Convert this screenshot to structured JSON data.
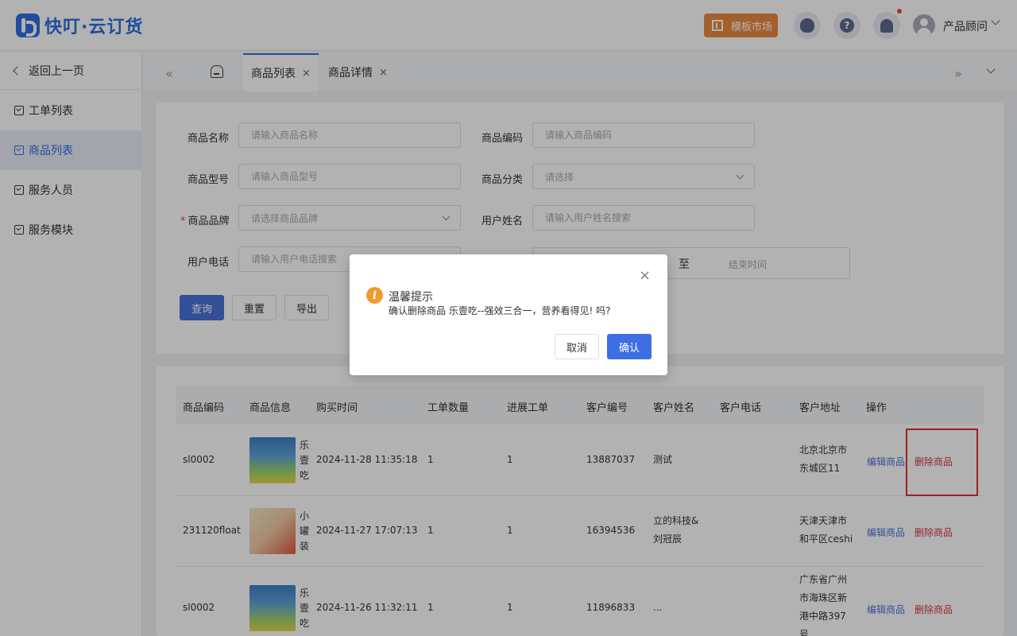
{
  "header": {
    "logo_text": "快叮·云订货",
    "template_market": "模板市场",
    "support_icon": "headset-icon",
    "help_icon": "question-icon",
    "help_glyph": "?",
    "bell_icon": "bell-icon",
    "user_name": "产品顾问"
  },
  "sidebar": {
    "back": "返回上一页",
    "items": [
      {
        "label": "工单列表"
      },
      {
        "label": "商品列表"
      },
      {
        "label": "服务人员"
      },
      {
        "label": "服务模块"
      }
    ]
  },
  "tabs": {
    "prev_glyph": "«",
    "next_glyph": "»",
    "items": [
      {
        "label": "商品列表",
        "close": "×"
      },
      {
        "label": "商品详情",
        "close": "×"
      }
    ]
  },
  "filters": {
    "product_name": {
      "label": "商品名称",
      "placeholder": "请输入商品名称"
    },
    "product_code": {
      "label": "商品编码",
      "placeholder": "请输入商品编码"
    },
    "product_model": {
      "label": "商品型号",
      "placeholder": "请输入商品型号"
    },
    "product_category": {
      "label": "商品分类",
      "placeholder": "请选择"
    },
    "product_brand": {
      "label": "商品品牌",
      "required_mark": "*",
      "placeholder": "请选择商品品牌"
    },
    "user_name": {
      "label": "用户姓名",
      "placeholder": "请输入用户姓名搜索"
    },
    "user_phone": {
      "label": "用户电话",
      "placeholder": "请输入用户电话搜索"
    },
    "date_separator": "至",
    "date_end_placeholder": "结束时间",
    "buttons": {
      "query": "查询",
      "reset": "重置",
      "export": "导出"
    }
  },
  "table": {
    "columns": [
      "商品编码",
      "商品信息",
      "购买时间",
      "工单数量",
      "进展工单",
      "客户编号",
      "客户姓名",
      "客户电话",
      "客户地址",
      "操作"
    ],
    "rows": [
      {
        "code": "sl0002",
        "name_lines": [
          "乐",
          "壹",
          "吃"
        ],
        "buy_time": "2024-11-28 11:35:18",
        "orders": "1",
        "progress": "1",
        "customer_no": "13887037",
        "customer_name_lines": [
          "测试"
        ],
        "phone": "",
        "address_lines": [
          "北京北京市",
          "东城区11"
        ],
        "edit": "编辑商品",
        "delete": "删除商品"
      },
      {
        "code": "231120float",
        "name_lines": [
          "小",
          "罐",
          "装"
        ],
        "buy_time": "2024-11-27 17:07:13",
        "orders": "1",
        "progress": "1",
        "customer_no": "16394536",
        "customer_name_lines": [
          "立的科技&",
          "刘冠辰"
        ],
        "phone": "",
        "address_lines": [
          "天津天津市",
          "和平区ceshi"
        ],
        "edit": "编辑商品",
        "delete": "删除商品"
      },
      {
        "code": "sl0002",
        "name_lines": [
          "乐",
          "壹",
          "吃"
        ],
        "buy_time": "2024-11-26 11:32:11",
        "orders": "1",
        "progress": "1",
        "customer_no": "11896833",
        "customer_name_lines": [
          "..."
        ],
        "phone": "",
        "address_lines": [
          "广东省广州",
          "市海珠区新",
          "港中路397",
          "号"
        ],
        "edit": "编辑商品",
        "delete": "删除商品"
      }
    ]
  },
  "dialog": {
    "title": "温馨提示",
    "message": "确认删除商品 乐壹吃--强效三合一，营养看得见! 吗?",
    "icon_glyph": "i",
    "close_glyph": "×",
    "cancel": "取消",
    "confirm": "确认"
  },
  "colors": {
    "brand": "#2f6fe0",
    "primary_button": "#3d6fe3",
    "template_button": "#ea8a3f",
    "delete_link": "#d9363e",
    "warning_icon": "#f29a2e",
    "highlight_border": "#e0302c"
  }
}
